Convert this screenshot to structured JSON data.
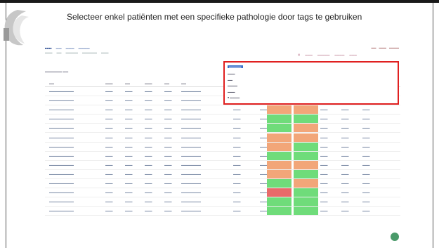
{
  "caption": "Selecteer enkel patiënten met een specifieke pathologie door tags te gebruiken",
  "colors": {
    "green": "#6fdc7a",
    "orange": "#f2a679",
    "red_marker": "#e86a6a",
    "highlight_border": "#e02020"
  },
  "row_status": [
    [
      "orange",
      "green"
    ],
    [
      "green",
      "orange"
    ],
    [
      "orange",
      "orange"
    ],
    [
      "green",
      "green"
    ],
    [
      "green",
      "orange"
    ],
    [
      "orange",
      "orange"
    ],
    [
      "orange",
      "green"
    ],
    [
      "green",
      "green"
    ],
    [
      "orange",
      "orange"
    ],
    [
      "orange",
      "green"
    ],
    [
      "green",
      "orange"
    ],
    [
      "red",
      "green"
    ],
    [
      "green",
      "green"
    ],
    [
      "green",
      "green"
    ]
  ]
}
